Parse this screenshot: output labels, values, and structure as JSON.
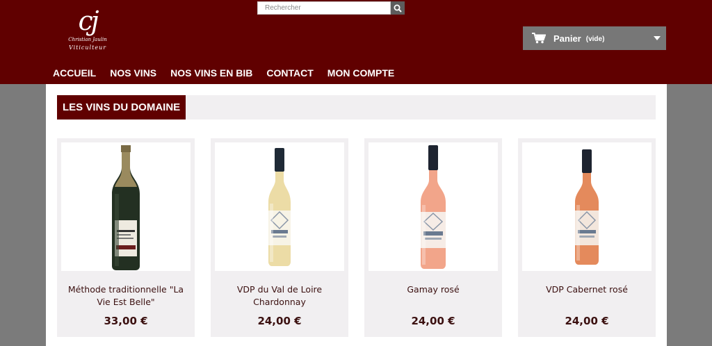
{
  "header": {
    "logo": {
      "mark": "cj",
      "name": "Christian Jaulin",
      "subtitle": "Viticulteur"
    },
    "search": {
      "placeholder": "Rechercher",
      "button_icon": "search-icon"
    },
    "cart": {
      "icon": "cart-icon",
      "label": "Panier",
      "status": "(vide)",
      "caret_icon": "caret-down-icon"
    },
    "nav": {
      "items": [
        {
          "label": "ACCUEIL"
        },
        {
          "label": "NOS VINS"
        },
        {
          "label": "NOS VINS EN BIB"
        },
        {
          "label": "CONTACT"
        },
        {
          "label": "MON COMPTE"
        }
      ]
    }
  },
  "main": {
    "section_title": "LES VINS DU DOMAINE",
    "products": [
      {
        "name": "Méthode traditionnelle \"La Vie Est Belle\"",
        "price": "33,00 €"
      },
      {
        "name": "VDP du Val de Loire Chardonnay",
        "price": "24,00 €"
      },
      {
        "name": "Gamay rosé",
        "price": "24,00 €"
      },
      {
        "name": "VDP Cabernet rosé",
        "price": "24,00 €"
      }
    ]
  },
  "colors": {
    "brand": "#600000",
    "text": "#3b1010",
    "card_bg": "#f1eff1",
    "page_bg": "#7b7b7b",
    "cart_bg": "#777777"
  }
}
